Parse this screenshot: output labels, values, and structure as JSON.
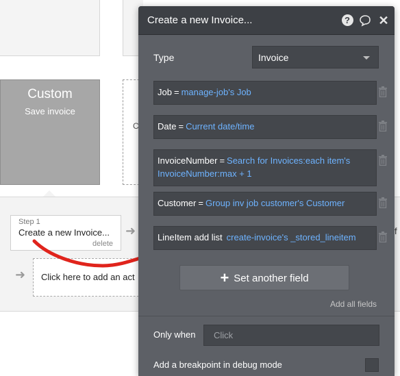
{
  "workflow": {
    "custom_block": {
      "title": "Custom",
      "subtitle": "Save invoice"
    },
    "dashed_block_letter": "C",
    "step": {
      "label": "Step 1",
      "title": "Create a new Invoice...",
      "delete_label": "delete"
    },
    "add_action_text": "Click here to add an act",
    "right_edge_text": "f"
  },
  "editor": {
    "title": "Create a new Invoice...",
    "icons": [
      "help-icon",
      "comment-icon",
      "close-icon"
    ],
    "type": {
      "label": "Type",
      "value": "Invoice"
    },
    "fields": [
      {
        "name": "Job",
        "eq": "=",
        "value": "manage-job's Job"
      },
      {
        "name": "Date",
        "eq": "=",
        "value": "Current date/time"
      },
      {
        "name": "InvoiceNumber",
        "eq": "=",
        "value": "Search for Invoices:each item's InvoiceNumber:max + 1"
      },
      {
        "name": "Customer",
        "eq": "=",
        "value": "Group inv job customer's Customer"
      },
      {
        "name": "LineItem add list",
        "eq": "",
        "value": "create-invoice's _stored_lineitem"
      }
    ],
    "set_another_field": "Set another field",
    "add_all_fields": "Add all fields",
    "only_when": {
      "label": "Only when",
      "placeholder": "Click"
    },
    "breakpoint_label": "Add a breakpoint in debug mode"
  },
  "colors": {
    "editor_bg": "#5d6066",
    "editor_header": "#3d4045",
    "field_bg": "#44474c",
    "link_blue": "#6eb3ff",
    "annotation_red": "#e0241c"
  }
}
